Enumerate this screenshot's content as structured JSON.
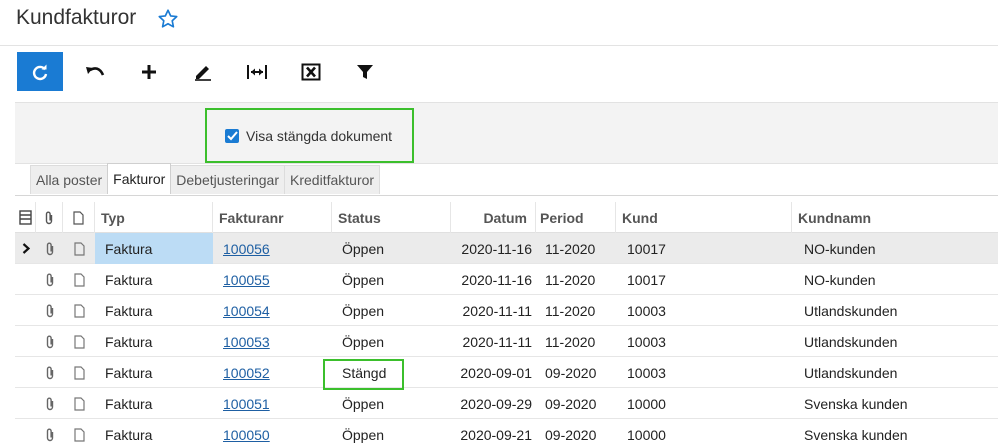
{
  "header": {
    "title": "Kundfakturor"
  },
  "filter": {
    "show_closed_label": "Visa stängda dokument",
    "show_closed_checked": true
  },
  "tabs": [
    {
      "label": "Alla poster",
      "active": false
    },
    {
      "label": "Fakturor",
      "active": true
    },
    {
      "label": "Debetjusteringar",
      "active": false
    },
    {
      "label": "Kreditfakturor",
      "active": false
    }
  ],
  "grid": {
    "columns": {
      "typ": "Typ",
      "fakturanr": "Fakturanr",
      "status": "Status",
      "datum": "Datum",
      "period": "Period",
      "kund": "Kund",
      "kundnamn": "Kundnamn"
    },
    "rows": [
      {
        "typ": "Faktura",
        "fakturanr": "100056",
        "status": "Öppen",
        "datum": "2020-11-16",
        "period": "11-2020",
        "kund": "10017",
        "kundnamn": "NO-kunden"
      },
      {
        "typ": "Faktura",
        "fakturanr": "100055",
        "status": "Öppen",
        "datum": "2020-11-16",
        "period": "11-2020",
        "kund": "10017",
        "kundnamn": "NO-kunden"
      },
      {
        "typ": "Faktura",
        "fakturanr": "100054",
        "status": "Öppen",
        "datum": "2020-11-11",
        "period": "11-2020",
        "kund": "10003",
        "kundnamn": "Utlandskunden"
      },
      {
        "typ": "Faktura",
        "fakturanr": "100053",
        "status": "Öppen",
        "datum": "2020-11-11",
        "period": "11-2020",
        "kund": "10003",
        "kundnamn": "Utlandskunden"
      },
      {
        "typ": "Faktura",
        "fakturanr": "100052",
        "status": "Stängd",
        "datum": "2020-09-01",
        "period": "09-2020",
        "kund": "10003",
        "kundnamn": "Utlandskunden"
      },
      {
        "typ": "Faktura",
        "fakturanr": "100051",
        "status": "Öppen",
        "datum": "2020-09-29",
        "period": "09-2020",
        "kund": "10000",
        "kundnamn": "Svenska kunden"
      },
      {
        "typ": "Faktura",
        "fakturanr": "100050",
        "status": "Öppen",
        "datum": "2020-09-21",
        "period": "09-2020",
        "kund": "10000",
        "kundnamn": "Svenska kunden"
      }
    ]
  },
  "colors": {
    "accent": "#1a7bd3",
    "highlight": "#3bbf2c",
    "link": "#1e5fa3",
    "selected_cell": "#bcdcf5"
  }
}
